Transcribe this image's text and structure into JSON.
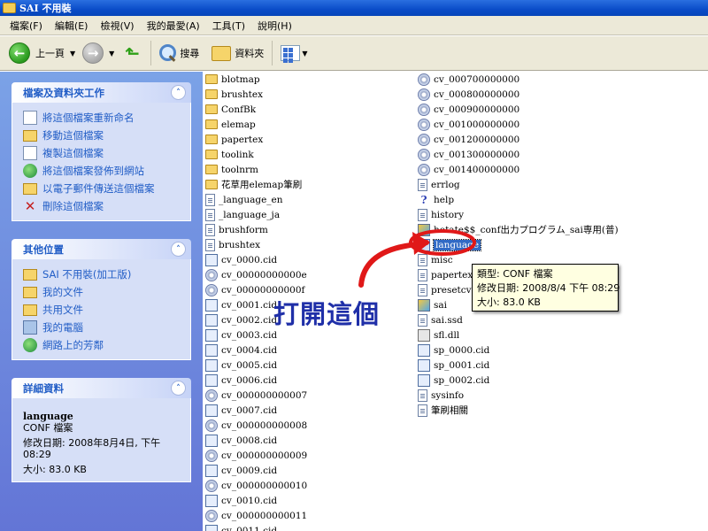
{
  "window": {
    "title": "SAI 不用裝"
  },
  "menu": [
    "檔案(F)",
    "編輯(E)",
    "檢視(V)",
    "我的最愛(A)",
    "工具(T)",
    "說明(H)"
  ],
  "toolbar": {
    "back_label": "上一頁",
    "search_label": "搜尋",
    "folders_label": "資料夾"
  },
  "tasks": {
    "title": "檔案及資料夾工作",
    "items": [
      "將這個檔案重新命名",
      "移動這個檔案",
      "複製這個檔案",
      "將這個檔案發佈到網站",
      "以電子郵件傳送這個檔案",
      "刪除這個檔案"
    ]
  },
  "places": {
    "title": "其他位置",
    "items": [
      "SAI 不用裝(加工版)",
      "我的文件",
      "共用文件",
      "我的電腦",
      "網路上的芳鄰"
    ]
  },
  "details": {
    "title": "詳細資料",
    "name": "language",
    "type": "CONF 檔案",
    "modified_line1": "修改日期: 2008年8月4日, 下午",
    "modified_line2": "08:29",
    "size": "大小: 83.0 KB"
  },
  "files_col1": [
    {
      "name": "blotmap",
      "icon": "folder"
    },
    {
      "name": "brushtex",
      "icon": "folder"
    },
    {
      "name": "ConfBk",
      "icon": "folder"
    },
    {
      "name": "elemap",
      "icon": "folder"
    },
    {
      "name": "papertex",
      "icon": "folder"
    },
    {
      "name": "toolink",
      "icon": "folder"
    },
    {
      "name": "toolnrm",
      "icon": "folder"
    },
    {
      "name": "花草用elemap筆刷",
      "icon": "folder"
    },
    {
      "name": "_language_en",
      "icon": "doc"
    },
    {
      "name": "_language_ja",
      "icon": "doc"
    },
    {
      "name": "brushform",
      "icon": "doc"
    },
    {
      "name": "brushtex",
      "icon": "doc"
    },
    {
      "name": "cv_0000.cid",
      "icon": "cid"
    },
    {
      "name": "cv_00000000000e",
      "icon": "cd"
    },
    {
      "name": "cv_00000000000f",
      "icon": "cd"
    },
    {
      "name": "cv_0001.cid",
      "icon": "cid"
    },
    {
      "name": "cv_0002.cid",
      "icon": "cid"
    },
    {
      "name": "cv_0003.cid",
      "icon": "cid"
    },
    {
      "name": "cv_0004.cid",
      "icon": "cid"
    },
    {
      "name": "cv_0005.cid",
      "icon": "cid"
    },
    {
      "name": "cv_0006.cid",
      "icon": "cid"
    },
    {
      "name": "cv_000000000007",
      "icon": "cd"
    },
    {
      "name": "cv_0007.cid",
      "icon": "cid"
    },
    {
      "name": "cv_000000000008",
      "icon": "cd"
    },
    {
      "name": "cv_0008.cid",
      "icon": "cid"
    },
    {
      "name": "cv_000000000009",
      "icon": "cd"
    },
    {
      "name": "cv_0009.cid",
      "icon": "cid"
    },
    {
      "name": "cv_000000000010",
      "icon": "cd"
    },
    {
      "name": "cv_0010.cid",
      "icon": "cid"
    },
    {
      "name": "cv_000000000011",
      "icon": "cd"
    },
    {
      "name": "cv_0011.cid",
      "icon": "cid"
    }
  ],
  "files_col2": [
    {
      "name": "cv_000700000000",
      "icon": "cd"
    },
    {
      "name": "cv_000800000000",
      "icon": "cd"
    },
    {
      "name": "cv_000900000000",
      "icon": "cd"
    },
    {
      "name": "cv_001000000000",
      "icon": "cd"
    },
    {
      "name": "cv_001200000000",
      "icon": "cd"
    },
    {
      "name": "cv_001300000000",
      "icon": "cd"
    },
    {
      "name": "cv_001400000000",
      "icon": "cd"
    },
    {
      "name": "errlog",
      "icon": "doc"
    },
    {
      "name": "help",
      "icon": "help"
    },
    {
      "name": "history",
      "icon": "doc"
    },
    {
      "name": "hotate$$_conf出力プログラム_sai専用(普)",
      "icon": "app"
    },
    {
      "name": "language",
      "icon": "conf",
      "selected": true
    },
    {
      "name": "misc",
      "icon": "doc"
    },
    {
      "name": "papertex",
      "icon": "doc"
    },
    {
      "name": "presetcvs",
      "icon": "doc"
    },
    {
      "name": "sai",
      "icon": "app"
    },
    {
      "name": "sai.ssd",
      "icon": "doc"
    },
    {
      "name": "sfl.dll",
      "icon": "gear"
    },
    {
      "name": "sp_0000.cid",
      "icon": "cid"
    },
    {
      "name": "sp_0001.cid",
      "icon": "cid"
    },
    {
      "name": "sp_0002.cid",
      "icon": "cid"
    },
    {
      "name": "sysinfo",
      "icon": "doc"
    },
    {
      "name": "筆刷相關",
      "icon": "doc"
    }
  ],
  "tooltip": {
    "type": "類型: CONF 檔案",
    "modified": "修改日期: 2008/8/4 下午 08:29",
    "size": "大小: 83.0 KB"
  },
  "annotation": {
    "text": "打開這個",
    "color": "#1f2fa8",
    "arrow_color": "#e01818"
  }
}
